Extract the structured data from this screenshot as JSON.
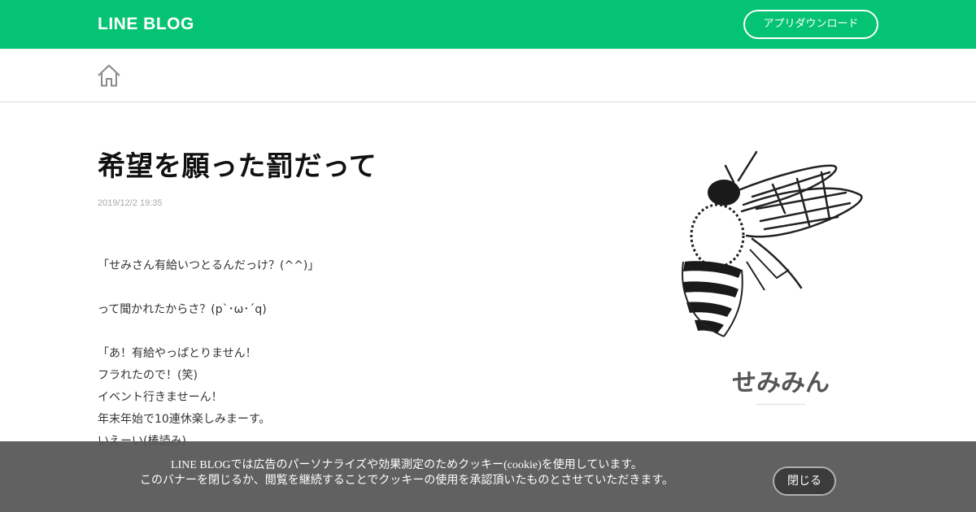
{
  "header": {
    "logo_text": "LINE BLOG",
    "app_download_label": "アプリダウンロード",
    "brand_color": "#04c372"
  },
  "subnav": {
    "home_icon": "home-icon"
  },
  "post": {
    "title": "希望を願った罰だって",
    "date": "2019/12/2 19:35",
    "body": [
      "「せみさん有給いつとるんだっけ？(^^)」",
      "",
      "って聞かれたからさ？(p`･ω･´q)",
      "",
      "「あ！有給やっぱとりません！",
      "フラれたので！(笑)",
      "イベント行きませーん！",
      "年末年始で10連休楽しみまーす。",
      "いえーい(棒読み)"
    ]
  },
  "sidebar": {
    "author_image_icon": "bee-illustration",
    "author_name": "せみみん"
  },
  "cookie_banner": {
    "line1": "LINE BLOGでは広告のパーソナライズや効果測定のためクッキー(cookie)を使用しています。",
    "line2": "このバナーを閉じるか、閲覧を継続することでクッキーの使用を承認頂いたものとさせていただきます。",
    "close_label": "閉じる"
  }
}
